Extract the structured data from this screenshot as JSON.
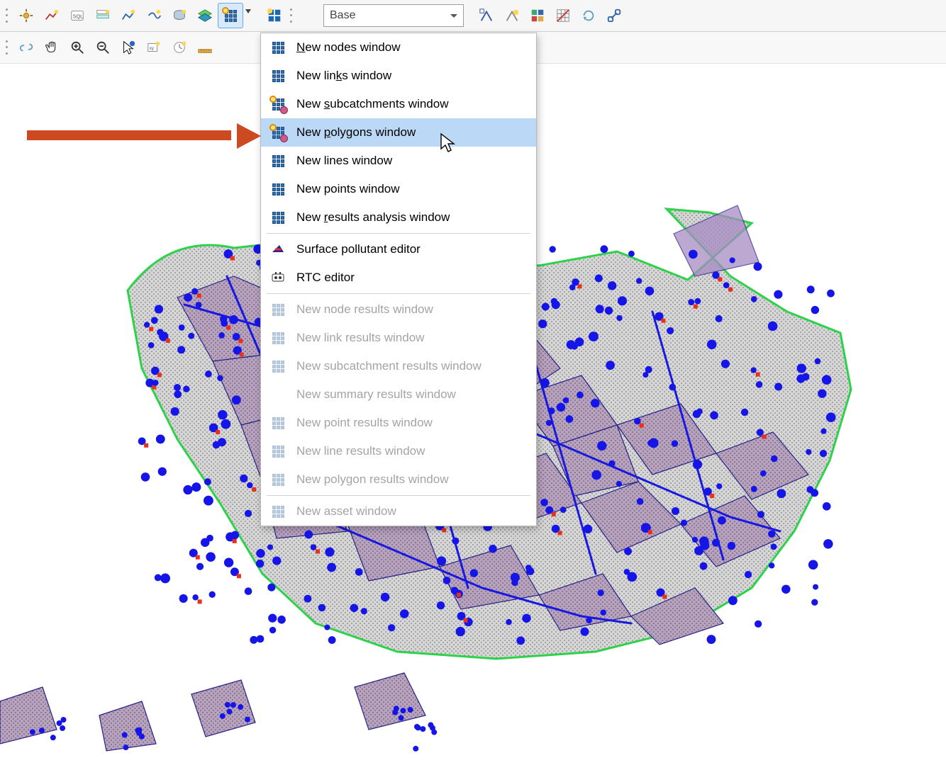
{
  "toolbar": {
    "combo_value": "Base",
    "buttons_row1": [
      {
        "name": "properties-gear-icon",
        "icon": "gear"
      },
      {
        "name": "graph-new-icon",
        "icon": "graph"
      },
      {
        "name": "sql-icon",
        "icon": "sql"
      },
      {
        "name": "insert-row-icon",
        "icon": "insertrow"
      },
      {
        "name": "profile-tool-icon",
        "icon": "profile"
      },
      {
        "name": "trace-tool-icon",
        "icon": "trace"
      },
      {
        "name": "cleanup-icon",
        "icon": "cleanup"
      },
      {
        "name": "layers-icon",
        "icon": "layers"
      },
      {
        "name": "new-grid-window-icon",
        "icon": "gridspark",
        "open": true,
        "split": true
      },
      {
        "name": "gear-grid-icon",
        "icon": "gearspark"
      }
    ],
    "buttons_row1_right": [
      {
        "name": "zoom-extents-icon",
        "icon": "zmA"
      },
      {
        "name": "zoom-topology-icon",
        "icon": "zmB"
      },
      {
        "name": "theme-icon",
        "icon": "theme"
      },
      {
        "name": "grid-off-icon",
        "icon": "gridoff"
      },
      {
        "name": "refresh-icon",
        "icon": "refresh"
      },
      {
        "name": "link-icon",
        "icon": "link"
      }
    ],
    "buttons_row2": [
      {
        "name": "chain-broken-icon",
        "icon": "chain"
      },
      {
        "name": "pan-hand-icon",
        "icon": "hand"
      },
      {
        "name": "zoom-in-icon",
        "icon": "zoomin"
      },
      {
        "name": "zoom-out-icon",
        "icon": "zoomout"
      },
      {
        "name": "select-cursor-icon",
        "icon": "cursor"
      },
      {
        "name": "find-by-xy-icon",
        "icon": "findxy"
      },
      {
        "name": "find-by-time-icon",
        "icon": "findtime"
      },
      {
        "name": "measure-icon",
        "icon": "measure"
      }
    ]
  },
  "dropdown": {
    "items": [
      {
        "label": "New nodes window",
        "hot": "n",
        "icon": "grid",
        "enabled": true
      },
      {
        "label": "New links window",
        "hot": "k",
        "icon": "grid",
        "enabled": true
      },
      {
        "label": "New subcatchments window",
        "hot": "s",
        "icon": "gridcircle",
        "enabled": true
      },
      {
        "label": "New polygons window",
        "hot": "p",
        "icon": "gridcircle",
        "enabled": true,
        "hovered": true
      },
      {
        "label": "New lines window",
        "hot": "",
        "icon": "grid",
        "enabled": true
      },
      {
        "label": "New points window",
        "hot": "",
        "icon": "grid",
        "enabled": true
      },
      {
        "label": "New results analysis window",
        "hot": "r",
        "icon": "grid",
        "enabled": true
      },
      {
        "sep": true
      },
      {
        "label": "Surface pollutant editor",
        "icon": "pollutant",
        "enabled": true
      },
      {
        "label": "RTC editor",
        "icon": "rtc",
        "enabled": true
      },
      {
        "sep": true
      },
      {
        "label": "New node results window",
        "icon": "grid",
        "enabled": false
      },
      {
        "label": "New link results window",
        "icon": "grid",
        "enabled": false
      },
      {
        "label": "New subcatchment results window",
        "icon": "grid",
        "enabled": false
      },
      {
        "label": "New summary results window",
        "icon": "none",
        "enabled": false
      },
      {
        "label": "New point results window",
        "icon": "grid",
        "enabled": false
      },
      {
        "label": "New line results window",
        "icon": "grid",
        "enabled": false
      },
      {
        "label": "New polygon results window",
        "icon": "grid",
        "enabled": false
      },
      {
        "sep": true
      },
      {
        "label": "New asset window",
        "icon": "grid",
        "enabled": false
      }
    ]
  }
}
